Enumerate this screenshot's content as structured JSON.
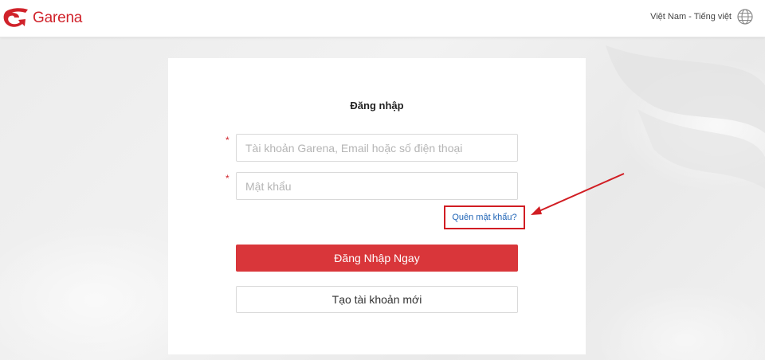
{
  "header": {
    "brand": "Garena",
    "language_label": "Việt Nam - Tiếng việt",
    "icons": {
      "logo": "garena-dragon-logo",
      "language": "globe-icon"
    }
  },
  "login": {
    "title": "Đăng nhập",
    "required_mark": "*",
    "account_placeholder": "Tài khoản Garena, Email hoặc số điện thoại",
    "account_value": "",
    "password_placeholder": "Mật khẩu",
    "password_value": "",
    "forgot_password": "Quên mật khẩu?",
    "login_button": "Đăng Nhập Ngay",
    "register_button": "Tạo tài khoản mới"
  },
  "annotation": {
    "type": "red-arrow-pointing-to-forgot-password"
  },
  "colors": {
    "brand_red": "#d0222a",
    "login_button": "#d9363a",
    "link_blue": "#1e63b5",
    "highlight_box": "#d11d23"
  }
}
